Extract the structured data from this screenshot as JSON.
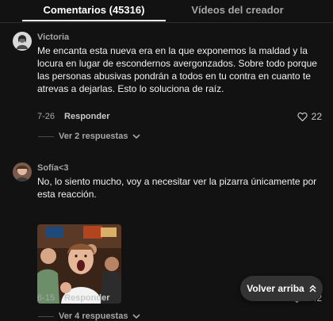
{
  "tabs": {
    "comments_label": "Comentarios (45316)",
    "creator_videos_label": "Vídeos del creador"
  },
  "comments": [
    {
      "user": "Victoria",
      "text": "Me encanta esta nueva era en la que exponemos la maldad y la locura en lugar de escondernos avergonzados. Sobre todo porque las personas abusivas pondrán a todos en tu contra en cuanto te atrevas a dejarlas. Esto lo soluciona de raíz.",
      "date": "7-26",
      "reply_label": "Responder",
      "likes": "22",
      "view_replies": "Ver 2 respuestas"
    },
    {
      "user": "Sofía<3",
      "text": "No, lo siento mucho, voy a necesitar ver la pizarra únicamente por esta reacción.",
      "date": "6-15",
      "reply_label": "Responder",
      "likes": "542",
      "view_replies": "Ver 4 respuestas"
    }
  ],
  "back_to_top_label": "Volver arriba",
  "icons": {
    "heart": "heart-icon",
    "chevron": "chevron-down-icon",
    "back_to_top": "double-chevron-up-icon"
  }
}
